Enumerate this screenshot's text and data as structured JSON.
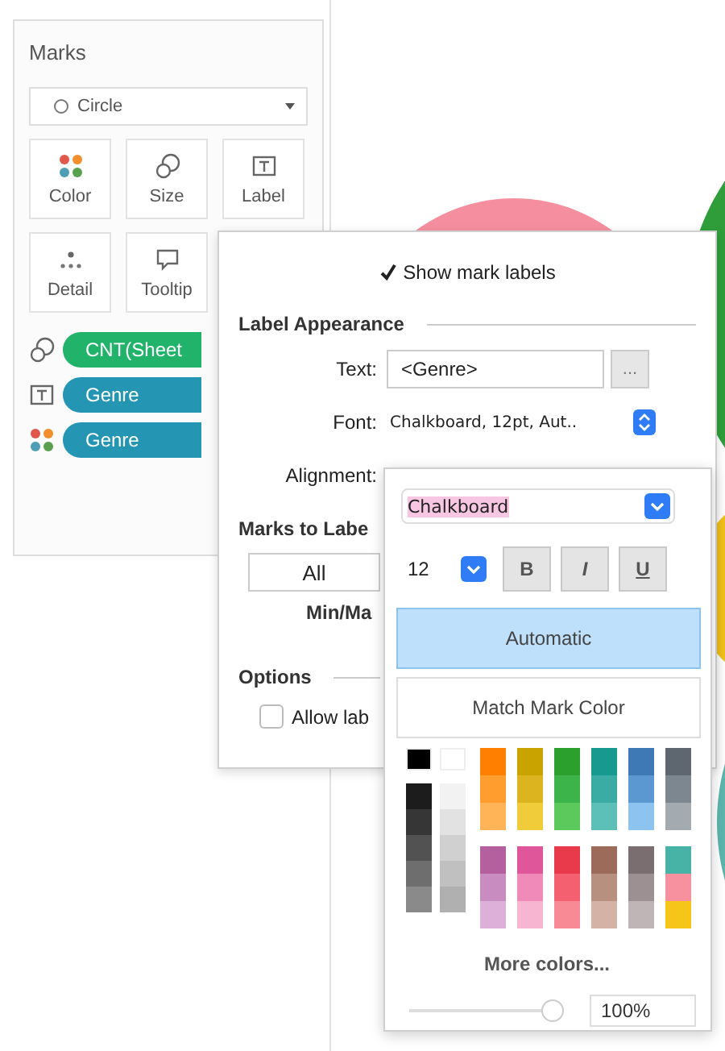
{
  "bubbles": [
    {
      "color": "#f58fa0"
    },
    {
      "color": "#2f9e3a"
    },
    {
      "color": "#f2c21b"
    },
    {
      "color": "#5bb5ad"
    }
  ],
  "marks_card": {
    "title": "Marks",
    "mark_type": "Circle",
    "buttons": [
      {
        "kind": "color",
        "label": "Color"
      },
      {
        "kind": "size",
        "label": "Size"
      },
      {
        "kind": "label",
        "label": "Label"
      },
      {
        "kind": "detail",
        "label": "Detail"
      },
      {
        "kind": "tooltip",
        "label": "Tooltip"
      }
    ],
    "shelf": [
      {
        "kind": "size",
        "label": "CNT(Sheet",
        "color": "#22b36b"
      },
      {
        "kind": "label",
        "label": "Genre",
        "color": "#2496b4"
      },
      {
        "kind": "color",
        "label": "Genre",
        "color": "#2496b4"
      }
    ]
  },
  "label_dialog": {
    "show_mark_labels": {
      "label": "Show mark labels",
      "checked": true
    },
    "appearance_heading": "Label Appearance",
    "text_label": "Text:",
    "text_value": "<Genre>",
    "more_button": "...",
    "font_label": "Font:",
    "font_value": "Chalkboard, 12pt, Aut..",
    "alignment_label": "Alignment:",
    "marks_heading": "Marks to Labe",
    "all_option": "All",
    "min_max_option": "Min/Ma",
    "options_heading": "Options",
    "allow_overlap": {
      "label": "Allow lab",
      "checked": false
    }
  },
  "font_popup": {
    "font_name": "Chalkboard",
    "font_size": "12",
    "style_buttons": [
      {
        "kind": "bold",
        "label": "B",
        "selected": false
      },
      {
        "kind": "italic",
        "label": "I",
        "selected": false
      },
      {
        "kind": "underline",
        "label": "U",
        "selected": false
      }
    ],
    "color_modes": [
      {
        "label": "Automatic",
        "selected": true
      },
      {
        "label": "Match Mark Color",
        "selected": false
      }
    ],
    "gray_columns": [
      {
        "swatches": [
          {
            "color": "#000000"
          },
          {
            "color": "#1c1c1c"
          },
          {
            "color": "#363636"
          },
          {
            "color": "#525252"
          },
          {
            "color": "#6e6e6e"
          },
          {
            "color": "#8a8a8a"
          }
        ]
      },
      {
        "swatches": [
          {
            "color": "#ffffff"
          },
          {
            "color": "#f2f2f2"
          },
          {
            "color": "#e2e2e2"
          },
          {
            "color": "#d0d0d0"
          },
          {
            "color": "#c0c0c0"
          },
          {
            "color": "#b0b0b0"
          }
        ]
      }
    ],
    "top_columns": [
      {
        "swatches": [
          {
            "color": "#ff8000"
          },
          {
            "color": "#ff9d2e"
          },
          {
            "color": "#ffb457"
          }
        ]
      },
      {
        "swatches": [
          {
            "color": "#c9a400"
          },
          {
            "color": "#dbb420"
          },
          {
            "color": "#f0cb3a"
          }
        ]
      },
      {
        "swatches": [
          {
            "color": "#2ca02c"
          },
          {
            "color": "#3cb44a"
          },
          {
            "color": "#5cc95c"
          }
        ]
      },
      {
        "swatches": [
          {
            "color": "#17998f"
          },
          {
            "color": "#3aaca4"
          },
          {
            "color": "#5cbfb8"
          }
        ]
      },
      {
        "swatches": [
          {
            "color": "#3e78b5"
          },
          {
            "color": "#5b98d2"
          },
          {
            "color": "#8cc4ef"
          }
        ]
      },
      {
        "swatches": [
          {
            "color": "#5e6770"
          },
          {
            "color": "#7d8790"
          },
          {
            "color": "#a3aab0"
          }
        ]
      }
    ],
    "bottom_columns": [
      {
        "swatches": [
          {
            "color": "#b4609f"
          },
          {
            "color": "#c98cc0"
          },
          {
            "color": "#dcb0d8"
          }
        ]
      },
      {
        "swatches": [
          {
            "color": "#e0569a"
          },
          {
            "color": "#f08ab8"
          },
          {
            "color": "#f8b5d2"
          }
        ]
      },
      {
        "swatches": [
          {
            "color": "#e83a4a"
          },
          {
            "color": "#f46070"
          },
          {
            "color": "#f88a95"
          }
        ]
      },
      {
        "swatches": [
          {
            "color": "#9c6b5a"
          },
          {
            "color": "#b89080"
          },
          {
            "color": "#d4b2a6"
          }
        ]
      },
      {
        "swatches": [
          {
            "color": "#7a6e70"
          },
          {
            "color": "#9c9092"
          },
          {
            "color": "#bfb4b6"
          }
        ]
      },
      {
        "swatches": [
          {
            "color": "#46b3a6"
          },
          {
            "color": "#f7909f"
          },
          {
            "color": "#f5c518"
          }
        ]
      }
    ],
    "more_colors": "More colors...",
    "opacity": {
      "level": 0.95,
      "value": "100%"
    }
  }
}
